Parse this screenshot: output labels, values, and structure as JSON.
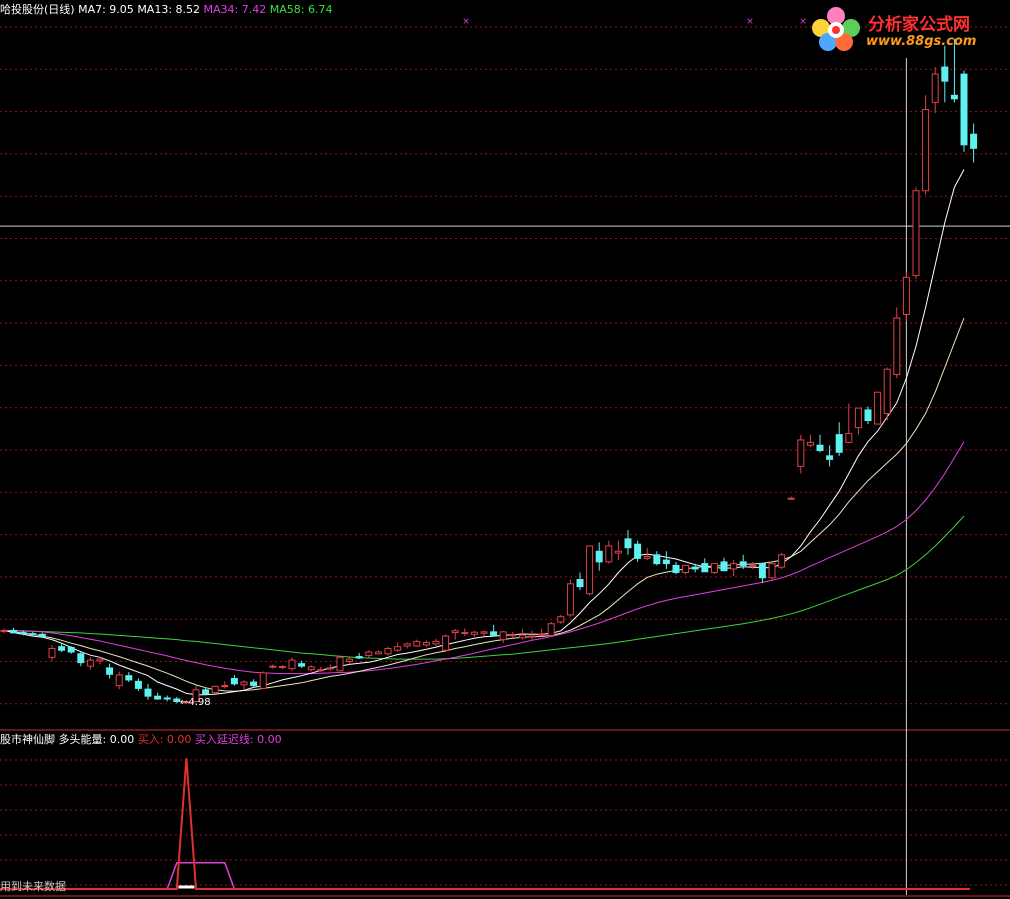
{
  "header": {
    "title": "哈投股份(日线)",
    "ma7": "MA7: 9.05",
    "ma13": "MA13: 8.52",
    "ma34": "MA34: 7.42",
    "ma58": "MA58: 6.74"
  },
  "indicator_header": {
    "title": "股市神仙脚",
    "energy": "多头能量: 0.00",
    "buy": "买入: 0.00",
    "buy_delay": "买入延迟线: 0.00"
  },
  "logo": {
    "title": "分析家公式网",
    "url": "www.88gs.com"
  },
  "low_label": "←4.98",
  "future_note": "用到未来数据",
  "colors": {
    "up": "#e0404a",
    "down": "#60f0f0",
    "ma7": "#ffffff",
    "ma13": "#e8e8c0",
    "ma34": "#e040e0",
    "ma58": "#40d040",
    "grid": "#8a1a1a",
    "buy": "#e03030",
    "buy_delay": "#e040e0"
  },
  "chart_data": [
    {
      "type": "candlestick",
      "title": "哈投股份(日线)",
      "ohlc": [
        [
          7.05,
          7.12,
          6.98,
          7.06
        ],
        [
          7.06,
          7.14,
          6.98,
          6.99
        ],
        [
          7.0,
          7.06,
          6.92,
          6.96
        ],
        [
          6.97,
          7.02,
          6.9,
          6.94
        ],
        [
          6.95,
          7.0,
          6.85,
          6.88
        ],
        [
          6.3,
          6.65,
          6.2,
          6.55
        ],
        [
          6.6,
          6.72,
          6.45,
          6.5
        ],
        [
          6.58,
          6.62,
          6.4,
          6.45
        ],
        [
          6.4,
          6.48,
          6.05,
          6.15
        ],
        [
          6.05,
          6.3,
          5.95,
          6.22
        ],
        [
          6.2,
          6.32,
          6.1,
          6.25
        ],
        [
          6.0,
          6.12,
          5.7,
          5.82
        ],
        [
          5.5,
          5.9,
          5.4,
          5.8
        ],
        [
          5.78,
          5.88,
          5.6,
          5.66
        ],
        [
          5.62,
          5.7,
          5.35,
          5.42
        ],
        [
          5.4,
          5.55,
          5.1,
          5.2
        ],
        [
          5.2,
          5.3,
          5.1,
          5.12
        ],
        [
          5.15,
          5.22,
          5.05,
          5.12
        ],
        [
          5.12,
          5.18,
          5.0,
          5.05
        ],
        [
          5.02,
          5.08,
          4.98,
          5.04
        ],
        [
          5.05,
          5.5,
          5.02,
          5.38
        ],
        [
          5.38,
          5.45,
          5.24,
          5.27
        ],
        [
          5.3,
          5.5,
          5.28,
          5.48
        ],
        [
          5.48,
          5.62,
          5.42,
          5.5
        ],
        [
          5.7,
          5.8,
          5.5,
          5.55
        ],
        [
          5.52,
          5.65,
          5.4,
          5.6
        ],
        [
          5.6,
          5.68,
          5.45,
          5.5
        ],
        [
          5.42,
          5.9,
          5.4,
          5.86
        ],
        [
          6.05,
          6.1,
          5.98,
          6.05
        ],
        [
          6.02,
          6.08,
          5.96,
          6.04
        ],
        [
          5.98,
          6.3,
          5.92,
          6.22
        ],
        [
          6.12,
          6.2,
          6.0,
          6.05
        ],
        [
          5.95,
          6.08,
          5.9,
          6.03
        ],
        [
          5.93,
          6.02,
          5.88,
          5.95
        ],
        [
          6.0,
          6.1,
          5.92,
          6.0
        ],
        [
          5.92,
          6.35,
          5.9,
          6.3
        ],
        [
          6.18,
          6.3,
          6.1,
          6.25
        ],
        [
          6.32,
          6.42,
          6.25,
          6.28
        ],
        [
          6.35,
          6.5,
          6.3,
          6.45
        ],
        [
          6.4,
          6.5,
          6.38,
          6.45
        ],
        [
          6.4,
          6.6,
          6.35,
          6.55
        ],
        [
          6.5,
          6.72,
          6.46,
          6.6
        ],
        [
          6.62,
          6.72,
          6.55,
          6.68
        ],
        [
          6.62,
          6.8,
          6.6,
          6.75
        ],
        [
          6.65,
          6.78,
          6.6,
          6.72
        ],
        [
          6.68,
          6.82,
          6.62,
          6.75
        ],
        [
          6.5,
          6.95,
          6.45,
          6.9
        ],
        [
          7.0,
          7.1,
          6.8,
          7.05
        ],
        [
          6.98,
          7.12,
          6.9,
          7.0
        ],
        [
          6.95,
          7.05,
          6.88,
          7.01
        ],
        [
          6.98,
          7.06,
          6.9,
          7.02
        ],
        [
          7.02,
          7.22,
          6.95,
          6.92
        ],
        [
          6.8,
          7.05,
          6.7,
          7.02
        ],
        [
          6.92,
          7.02,
          6.85,
          6.94
        ],
        [
          6.85,
          7.1,
          6.8,
          6.93
        ],
        [
          6.9,
          7.05,
          6.78,
          6.9
        ],
        [
          6.95,
          7.1,
          6.9,
          6.95
        ],
        [
          6.92,
          7.3,
          6.88,
          7.25
        ],
        [
          7.3,
          7.5,
          7.25,
          7.45
        ],
        [
          7.5,
          8.5,
          7.45,
          8.38
        ],
        [
          8.5,
          8.7,
          8.2,
          8.3
        ],
        [
          8.1,
          9.45,
          8.05,
          9.45
        ],
        [
          9.3,
          9.55,
          8.75,
          9.0
        ],
        [
          9.0,
          9.6,
          8.95,
          9.45
        ],
        [
          9.25,
          9.6,
          9.05,
          9.3
        ],
        [
          9.65,
          9.9,
          9.2,
          9.4
        ],
        [
          9.5,
          9.6,
          9.0,
          9.1
        ],
        [
          9.1,
          9.4,
          9.05,
          9.15
        ],
        [
          9.2,
          9.3,
          8.9,
          8.95
        ],
        [
          9.05,
          9.3,
          8.8,
          8.95
        ],
        [
          8.9,
          9.0,
          8.65,
          8.7
        ],
        [
          8.7,
          8.9,
          8.65,
          8.9
        ],
        [
          8.85,
          8.95,
          8.7,
          8.8
        ],
        [
          8.95,
          9.1,
          8.8,
          8.72
        ],
        [
          8.7,
          8.92,
          8.65,
          8.95
        ],
        [
          9.0,
          9.12,
          8.8,
          8.75
        ],
        [
          8.8,
          9.05,
          8.6,
          8.95
        ],
        [
          9.0,
          9.2,
          8.8,
          8.9
        ],
        [
          8.9,
          9.0,
          8.8,
          8.9
        ],
        [
          8.95,
          8.98,
          8.4,
          8.55
        ],
        [
          8.55,
          9.0,
          8.45,
          8.95
        ],
        [
          8.85,
          9.25,
          8.8,
          9.2
        ],
        [
          10.8,
          10.85,
          10.8,
          10.8
        ],
        [
          11.7,
          12.6,
          11.5,
          12.45
        ],
        [
          12.3,
          12.6,
          12.25,
          12.38
        ],
        [
          12.3,
          12.6,
          12.1,
          12.15
        ],
        [
          12.0,
          12.3,
          11.7,
          11.9
        ],
        [
          12.6,
          12.95,
          12.0,
          12.1
        ],
        [
          12.38,
          13.48,
          12.35,
          12.63
        ],
        [
          12.8,
          13.35,
          12.6,
          13.35
        ],
        [
          13.3,
          13.4,
          12.9,
          13.0
        ],
        [
          12.9,
          13.8,
          12.88,
          13.8
        ],
        [
          13.2,
          14.5,
          13.0,
          14.45
        ],
        [
          14.3,
          16.2,
          14.2,
          15.9
        ],
        [
          16.0,
          17.2,
          15.8,
          17.05
        ],
        [
          17.1,
          19.6,
          17.0,
          19.5
        ],
        [
          19.5,
          22.2,
          19.4,
          21.8
        ],
        [
          22.0,
          23.0,
          21.7,
          22.8
        ],
        [
          23.0,
          23.6,
          22.0,
          22.6
        ],
        [
          22.2,
          23.8,
          22.0,
          22.1
        ],
        [
          22.8,
          22.9,
          20.6,
          20.8
        ],
        [
          21.1,
          21.4,
          20.3,
          20.7
        ]
      ],
      "ma7": [
        7.06,
        7.0,
        6.95,
        6.9,
        6.87,
        6.8,
        6.7,
        6.58,
        6.46,
        6.36,
        6.3,
        6.2,
        6.08,
        5.98,
        5.88,
        5.78,
        5.6,
        5.5,
        5.4,
        5.28,
        5.24,
        5.24,
        5.26,
        5.29,
        5.33,
        5.37,
        5.45,
        5.5,
        5.58,
        5.66,
        5.72,
        5.78,
        5.85,
        5.93,
        6.0,
        6.05,
        6.1,
        6.13,
        6.16,
        6.22,
        6.3,
        6.38,
        6.42,
        6.47,
        6.53,
        6.59,
        6.66,
        6.72,
        6.78,
        6.84,
        6.88,
        6.9,
        6.92,
        6.94,
        6.96,
        6.95,
        6.95,
        6.98,
        7.05,
        7.28,
        7.55,
        7.85,
        8.1,
        8.37,
        8.7,
        8.97,
        9.18,
        9.22,
        9.18,
        9.13,
        9.08,
        9.0,
        8.92,
        8.86,
        8.84,
        8.82,
        8.83,
        8.86,
        8.85,
        8.84,
        8.83,
        8.95,
        9.15,
        9.45,
        9.85,
        10.2,
        10.6,
        11.0,
        11.5,
        12.0,
        12.4,
        12.7,
        13.1,
        13.5,
        14.2,
        15.1,
        16.2,
        17.4,
        18.6,
        19.6,
        20.1
      ],
      "ma13": [
        7.05,
        7.02,
        6.98,
        6.95,
        6.9,
        6.85,
        6.78,
        6.7,
        6.63,
        6.55,
        6.48,
        6.4,
        6.32,
        6.23,
        6.14,
        6.05,
        5.95,
        5.85,
        5.74,
        5.62,
        5.52,
        5.44,
        5.38,
        5.35,
        5.34,
        5.36,
        5.38,
        5.42,
        5.46,
        5.5,
        5.54,
        5.58,
        5.64,
        5.7,
        5.76,
        5.8,
        5.85,
        5.9,
        5.96,
        6.02,
        6.08,
        6.15,
        6.22,
        6.3,
        6.37,
        6.43,
        6.48,
        6.55,
        6.6,
        6.66,
        6.71,
        6.76,
        6.8,
        6.84,
        6.87,
        6.88,
        6.89,
        6.92,
        6.98,
        7.07,
        7.2,
        7.35,
        7.5,
        7.7,
        7.93,
        8.16,
        8.38,
        8.56,
        8.65,
        8.71,
        8.76,
        8.8,
        8.84,
        8.87,
        8.88,
        8.9,
        8.91,
        8.93,
        8.94,
        8.96,
        9.0,
        9.05,
        9.15,
        9.3,
        9.55,
        9.8,
        10.05,
        10.35,
        10.7,
        11.0,
        11.3,
        11.55,
        11.8,
        12.05,
        12.35,
        12.75,
        13.2,
        13.8,
        14.5,
        15.2,
        15.9
      ],
      "ma34": [
        7.06,
        7.06,
        7.05,
        7.04,
        7.02,
        6.99,
        6.95,
        6.91,
        6.86,
        6.81,
        6.76,
        6.7,
        6.64,
        6.58,
        6.52,
        6.46,
        6.4,
        6.34,
        6.27,
        6.21,
        6.15,
        6.09,
        6.04,
        5.99,
        5.95,
        5.91,
        5.88,
        5.86,
        5.85,
        5.84,
        5.84,
        5.84,
        5.84,
        5.85,
        5.86,
        5.87,
        5.88,
        5.9,
        5.92,
        5.95,
        5.98,
        6.02,
        6.06,
        6.1,
        6.15,
        6.2,
        6.25,
        6.3,
        6.36,
        6.42,
        6.48,
        6.54,
        6.6,
        6.66,
        6.72,
        6.78,
        6.83,
        6.89,
        6.95,
        7.02,
        7.1,
        7.18,
        7.27,
        7.37,
        7.47,
        7.57,
        7.67,
        7.76,
        7.84,
        7.91,
        7.97,
        8.02,
        8.07,
        8.12,
        8.17,
        8.22,
        8.27,
        8.32,
        8.37,
        8.42,
        8.48,
        8.55,
        8.64,
        8.75,
        8.88,
        9.0,
        9.12,
        9.24,
        9.36,
        9.48,
        9.6,
        9.72,
        9.85,
        10.0,
        10.2,
        10.45,
        10.75,
        11.1,
        11.5,
        11.95,
        12.4
      ],
      "ma58": [
        7.05,
        7.05,
        7.04,
        7.04,
        7.03,
        7.02,
        7.01,
        7.0,
        6.99,
        6.97,
        6.96,
        6.94,
        6.92,
        6.9,
        6.88,
        6.86,
        6.84,
        6.82,
        6.8,
        6.77,
        6.75,
        6.72,
        6.69,
        6.66,
        6.63,
        6.6,
        6.57,
        6.54,
        6.51,
        6.48,
        6.45,
        6.42,
        6.4,
        6.38,
        6.35,
        6.33,
        6.31,
        6.29,
        6.28,
        6.27,
        6.26,
        6.25,
        6.25,
        6.25,
        6.25,
        6.25,
        6.26,
        6.27,
        6.29,
        6.31,
        6.33,
        6.35,
        6.37,
        6.39,
        6.42,
        6.45,
        6.48,
        6.51,
        6.54,
        6.57,
        6.6,
        6.63,
        6.66,
        6.69,
        6.73,
        6.77,
        6.81,
        6.85,
        6.89,
        6.93,
        6.97,
        7.01,
        7.05,
        7.09,
        7.13,
        7.17,
        7.21,
        7.25,
        7.3,
        7.35,
        7.4,
        7.46,
        7.53,
        7.61,
        7.7,
        7.8,
        7.9,
        8.0,
        8.1,
        8.2,
        8.3,
        8.4,
        8.5,
        8.62,
        8.78,
        8.98,
        9.2,
        9.45,
        9.72,
        10.0,
        10.3
      ],
      "ylim": [
        4.3,
        24.5
      ],
      "low_annotation": 4.98,
      "crosshair_index": 94,
      "crosshair_price": 18.5
    },
    {
      "type": "line",
      "title": "股市神仙脚",
      "series": [
        {
          "name": "买入",
          "values": [
            0,
            0,
            0,
            0,
            0,
            0,
            0,
            0,
            0,
            0,
            0,
            0,
            0,
            0,
            0,
            0,
            0,
            0,
            0,
            0,
            0,
            0,
            0,
            0,
            0,
            0,
            0,
            0,
            0,
            0,
            0,
            0,
            0,
            0,
            0,
            0,
            0,
            0,
            0,
            0,
            0,
            0,
            0,
            0,
            0,
            0,
            0,
            0,
            0,
            0,
            0,
            0,
            0,
            0,
            0,
            0,
            0,
            0,
            0,
            0,
            0,
            0,
            0,
            0,
            0,
            0,
            0,
            0,
            0,
            0,
            0,
            0,
            0,
            0,
            0,
            0,
            0,
            0,
            0,
            0,
            0,
            0,
            0,
            0,
            0,
            0,
            0,
            0,
            0,
            0,
            0,
            0,
            0,
            0,
            0,
            0,
            0,
            0,
            0,
            0,
            0,
            0
          ]
        },
        {
          "name": "买入延迟线",
          "values": [
            0,
            0,
            0,
            0,
            0,
            0,
            0,
            0,
            0,
            0,
            0,
            0,
            0,
            0,
            0,
            0,
            0,
            0,
            0,
            0,
            0,
            0,
            0,
            0,
            0,
            0,
            0,
            0,
            0,
            0,
            0,
            0,
            0,
            0,
            0,
            0,
            0,
            0,
            0,
            0,
            0,
            0,
            0,
            0,
            0,
            0,
            0,
            0,
            0,
            0,
            0,
            0,
            0,
            0,
            0,
            0,
            0,
            0,
            0,
            0,
            0,
            0,
            0,
            0,
            0,
            0,
            0,
            0,
            0,
            0,
            0,
            0,
            0,
            0,
            0,
            0,
            0,
            0,
            0,
            0,
            0,
            0,
            0,
            0,
            0,
            0,
            0,
            0,
            0,
            0,
            0,
            0,
            0,
            0,
            0,
            0,
            0,
            0,
            0,
            0,
            0,
            0
          ]
        }
      ],
      "buy_spike_index": 19,
      "buy_spike_value": 100,
      "buy_delay_plateau": [
        17,
        23,
        20
      ],
      "ylim": [
        0,
        110
      ]
    }
  ]
}
